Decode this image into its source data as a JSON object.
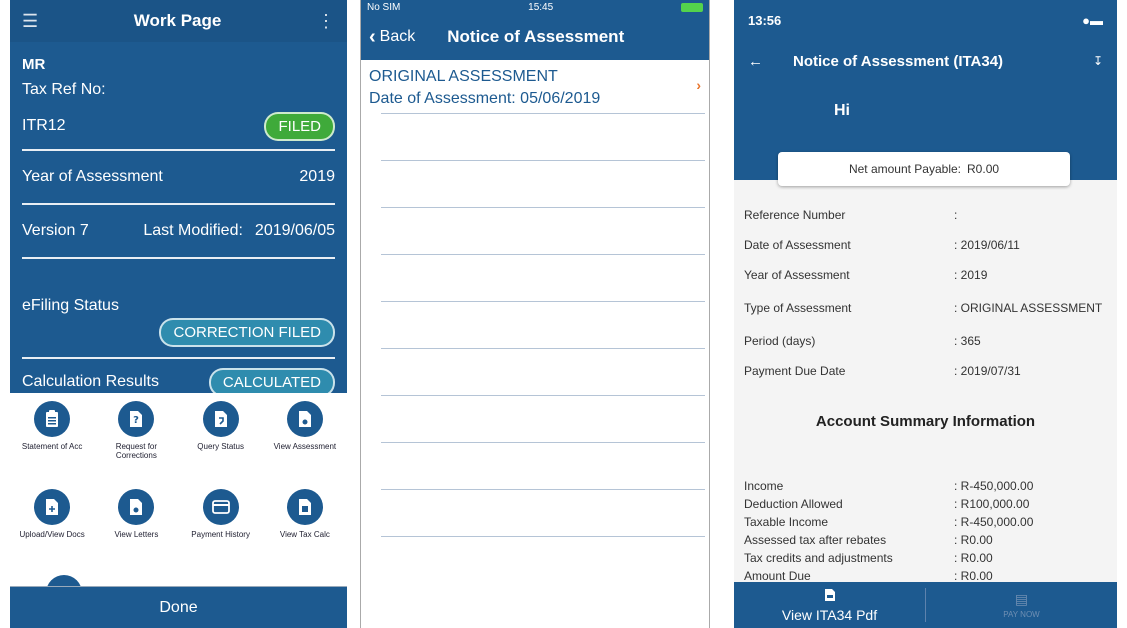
{
  "work_page": {
    "title": "Work Page",
    "name": "MR",
    "tax_ref_label": "Tax Ref No:",
    "return_type": "ITR12",
    "return_status": "FILED",
    "year_label": "Year of Assessment",
    "year_value": "2019",
    "version_label": "Version 7",
    "last_modified_label": "Last Modified:",
    "last_modified_value": "2019/06/05",
    "efiling_label": "eFiling Status",
    "efiling_status": "CORRECTION FILED",
    "calc_label": "Calculation Results",
    "calc_status": "CALCULATED",
    "tiles": [
      {
        "label": "Statement of Acc",
        "icon": "clipboard-icon"
      },
      {
        "label": "Request for Corrections",
        "icon": "question-doc-icon"
      },
      {
        "label": "Query Status",
        "icon": "doc-arrow-icon"
      },
      {
        "label": "View Assessment",
        "icon": "doc-view-icon"
      },
      {
        "label": "Upload/View Docs",
        "icon": "doc-plus-icon"
      },
      {
        "label": "View Letters",
        "icon": "letter-icon"
      },
      {
        "label": "Payment History",
        "icon": "card-icon"
      },
      {
        "label": "View Tax Calc",
        "icon": "calc-doc-icon"
      }
    ],
    "done_label": "Done"
  },
  "notice": {
    "status_carrier": "No SIM",
    "status_time": "15:45",
    "back_label": "Back",
    "title": "Notice of Assessment",
    "record_type": "ORIGINAL ASSESSMENT",
    "record_date": "Date of Assessment: 05/06/2019"
  },
  "ita34": {
    "status_time": "13:56",
    "title": "Notice of Assessment (ITA34)",
    "greeting": "Hi",
    "net_label": "Net amount Payable:",
    "net_value": "R0.00",
    "details": [
      {
        "label": "Reference Number",
        "value": ":"
      },
      {
        "label": "Date of Assessment",
        "value": ": 2019/06/11"
      },
      {
        "label": "Year of Assessment",
        "value": ": 2019"
      },
      {
        "label": "Type of Assessment",
        "value": ": ORIGINAL ASSESSMENT"
      },
      {
        "label": "Period (days)",
        "value": ": 365"
      },
      {
        "label": "Payment Due Date",
        "value": ": 2019/07/31"
      }
    ],
    "section_title": "Account Summary Information",
    "summary": [
      {
        "label": "Income",
        "value": ": R-450,000.00"
      },
      {
        "label": "Deduction Allowed",
        "value": ": R100,000.00"
      },
      {
        "label": "Taxable Income",
        "value": ": R-450,000.00"
      },
      {
        "label": "Assessed tax after rebates",
        "value": ": R0.00"
      },
      {
        "label": "Tax credits and adjustments",
        "value": ": R0.00"
      },
      {
        "label": "Amount Due",
        "value": ": R0.00"
      }
    ],
    "pdf_label": "View ITA34 Pdf",
    "pay_label": "PAY NOW"
  },
  "colors": {
    "primary": "#1d5a90",
    "filed": "#3faa3a",
    "status_pill": "#2f8cae",
    "accent": "#e8742a"
  }
}
